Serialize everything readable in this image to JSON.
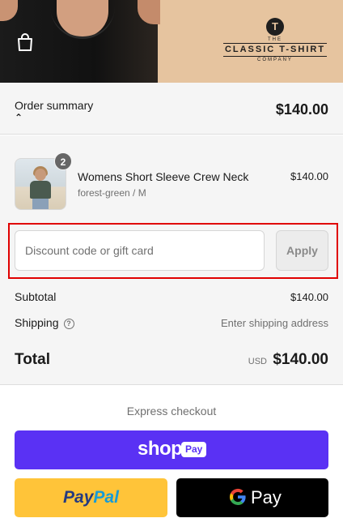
{
  "header": {
    "logo": {
      "badge_letter": "T",
      "the": "THE",
      "name": "CLASSIC T-SHIRT",
      "company": "COMPANY"
    },
    "banner_color": "#e6c49f"
  },
  "summary_bar": {
    "label": "Order summary",
    "toggle_icon": "chevron-up-icon",
    "total": "$140.00"
  },
  "order": {
    "items": [
      {
        "name": "Womens Short Sleeve Crew Neck",
        "variant": "forest-green / M",
        "price": "$140.00",
        "quantity": "2"
      }
    ],
    "discount": {
      "placeholder": "Discount code or gift card",
      "value": "",
      "apply_label": "Apply"
    },
    "subtotal_label": "Subtotal",
    "subtotal_value": "$140.00",
    "shipping_label": "Shipping",
    "shipping_value": "Enter shipping address",
    "total_label": "Total",
    "total_currency": "USD",
    "total_value": "$140.00"
  },
  "express": {
    "label": "Express checkout",
    "shop_pay": {
      "word": "shop",
      "tag": "Pay",
      "color": "#5a31f4"
    },
    "paypal": {
      "part1": "Pay",
      "part2": "Pal",
      "color": "#ffc439"
    },
    "gpay": {
      "g": "G",
      "word": "Pay",
      "color": "#000000"
    }
  },
  "colors": {
    "highlight_frame": "#e00000",
    "panel_bg": "#f5f5f5"
  }
}
